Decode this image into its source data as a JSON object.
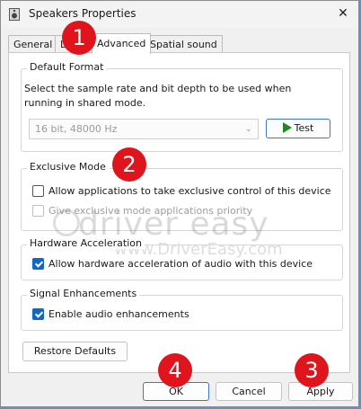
{
  "window": {
    "title": "Speakers Properties",
    "close_glyph": "✕"
  },
  "tabs": [
    {
      "label": "General"
    },
    {
      "label": "Levels"
    },
    {
      "label": "Advanced"
    },
    {
      "label": "Spatial sound"
    }
  ],
  "default_format": {
    "title": "Default Format",
    "description": "Select the sample rate and bit depth to be used when running in shared mode.",
    "selected": "16 bit, 48000 Hz",
    "test_label": "Test"
  },
  "exclusive_mode": {
    "title": "Exclusive Mode",
    "allow_exclusive": "Allow applications to take exclusive control of this device",
    "allow_exclusive_checked": false,
    "priority": "Give exclusive mode applications priority",
    "priority_checked": false
  },
  "hardware_acceleration": {
    "title": "Hardware Acceleration",
    "allow_hw": "Allow hardware acceleration of audio with this device",
    "allow_hw_checked": true
  },
  "signal_enhancements": {
    "title": "Signal Enhancements",
    "enable": "Enable audio enhancements",
    "enable_checked": true
  },
  "buttons": {
    "restore": "Restore Defaults",
    "ok": "OK",
    "cancel": "Cancel",
    "apply": "Apply"
  },
  "watermark": {
    "brand": "driver easy",
    "url": "www.DriverEasy.com"
  },
  "badges": [
    "1",
    "2",
    "3",
    "4"
  ],
  "colors": {
    "badge": "#e0141c",
    "checkbox": "#1366c4",
    "play": "#1a8c1a"
  }
}
